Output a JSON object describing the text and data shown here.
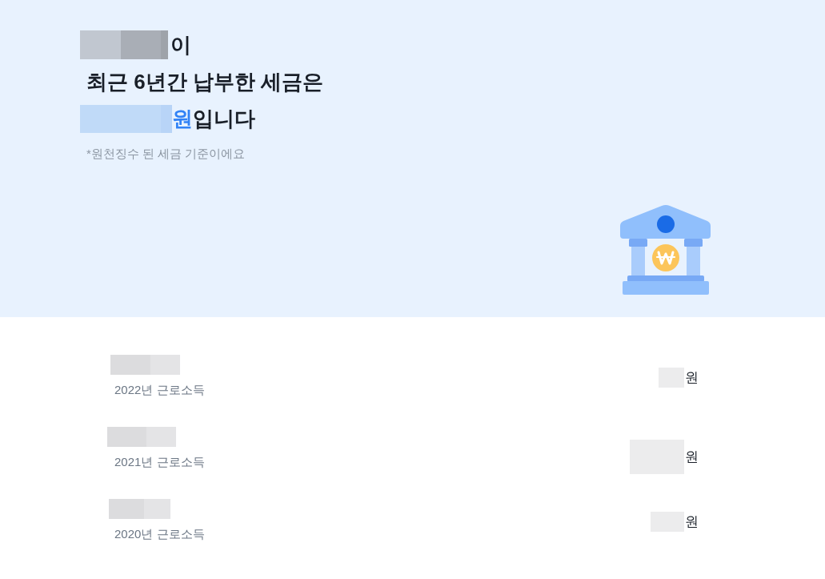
{
  "header": {
    "title_suffix": "이",
    "title_line": "최근 6년간 납부한 세금은",
    "amount_unit": "원",
    "amount_suffix": "입니다",
    "note": "*원천징수 된 세금 기준이에요"
  },
  "rows": [
    {
      "label": "2022년 근로소득",
      "unit": "원"
    },
    {
      "label": "2021년 근로소득",
      "unit": "원"
    },
    {
      "label": "2020년 근로소득",
      "unit": "원"
    }
  ]
}
